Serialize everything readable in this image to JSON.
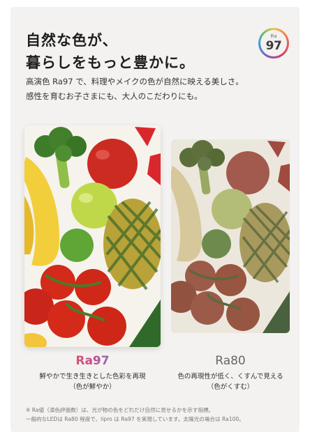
{
  "headline": {
    "line1": "自然な色が、",
    "line2": "暮らしをもっと豊かに。"
  },
  "badge": {
    "label": "Ra",
    "value": "97"
  },
  "lead": {
    "line1": "高演色 Ra97 で、料理やメイクの色が自然に映える美しさ。",
    "line2": "感性を育むお子さまにも、大人のこだわりにも。"
  },
  "comparison": {
    "left": {
      "title": "Ra97",
      "desc1": "鮮やかで生き生きとした色彩を再現",
      "desc2": "（色が鮮やか）"
    },
    "right": {
      "title": "Ra80",
      "desc1": "色の再現性が低く、くすんで見える",
      "desc2": "（色がくすむ）"
    }
  },
  "note": {
    "line1": "※ Ra値（演色評価数）は、光が物の色をどれだけ自然に見せるかを示す指標。",
    "line2": "一般的なLEDは Ra80 程度で、lipro は Ra97 を実現しています。太陽光の場合は Ra100。"
  },
  "colors": {
    "vivid_tomato": "#d42a1a",
    "dull_tomato": "#9c5a48",
    "vivid_banana": "#f2cf3a",
    "dull_banana": "#d6c89a",
    "vivid_apple": "#cc2b22",
    "dull_apple": "#a25a4e"
  }
}
